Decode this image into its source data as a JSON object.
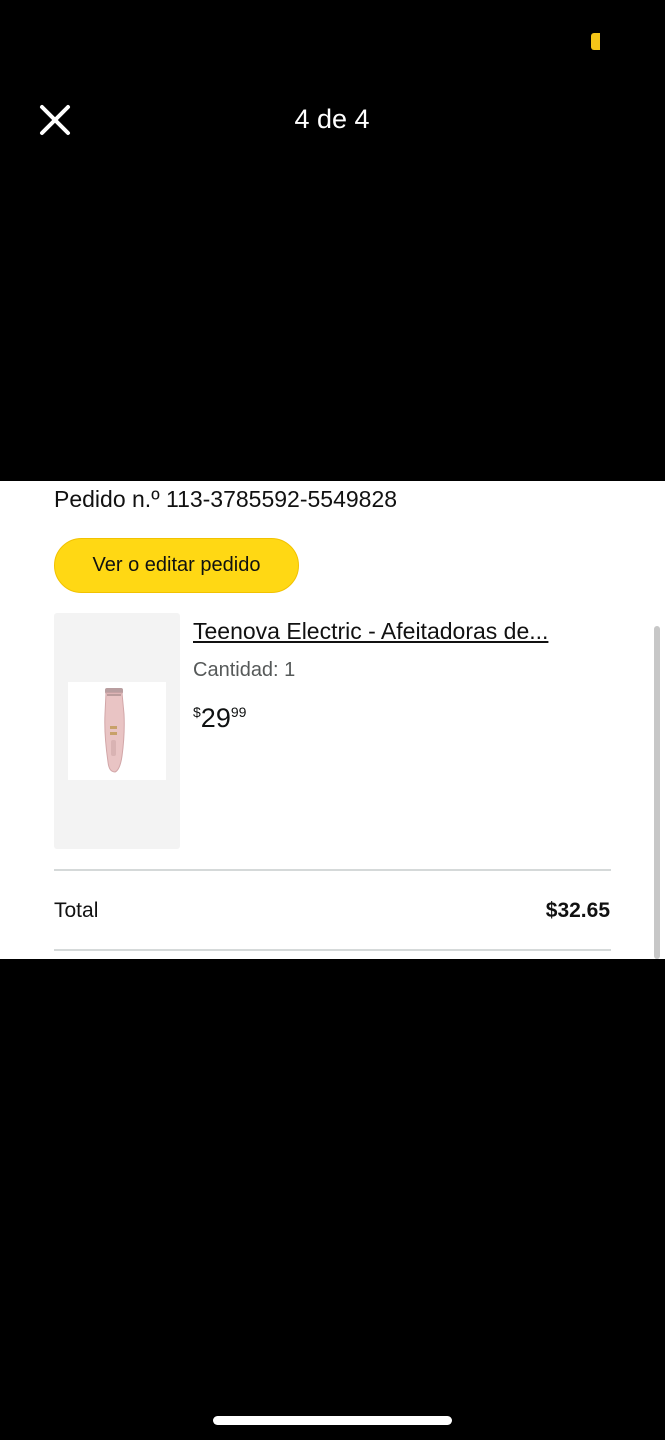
{
  "viewer": {
    "counter": "4 de 4",
    "close_icon": "close-icon"
  },
  "order": {
    "number_text": "Pedido n.º 113-3785592-5549828",
    "edit_button_label": "Ver o editar pedido",
    "item": {
      "title": "Teenova Electric - Afeitadoras de...",
      "quantity_text": "Cantidad: 1",
      "price_symbol": "$",
      "price_whole": "29",
      "price_fraction": "99",
      "image_icon": "electric-shaver-product-image"
    },
    "total_label": "Total",
    "total_value": "$32.65"
  },
  "colors": {
    "background": "#000000",
    "panel": "#ffffff",
    "button_yellow": "#ffd814",
    "status_yellow": "#f5c518",
    "divider": "#d5d9d9"
  }
}
